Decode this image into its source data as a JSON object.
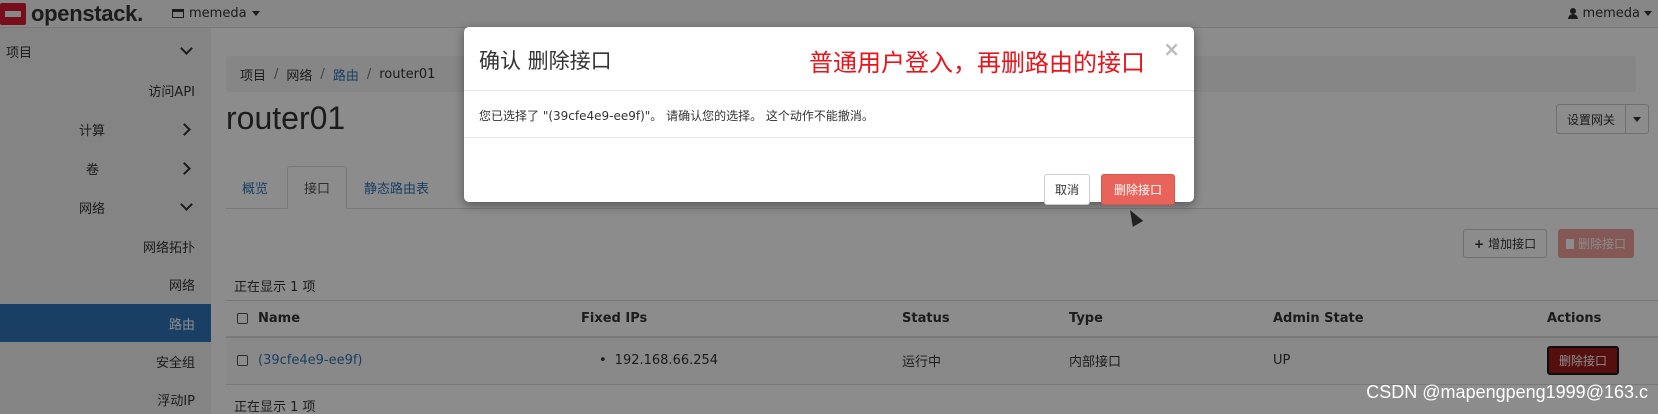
{
  "topbar": {
    "logo_text": "openstack.",
    "project_label": "memeda",
    "user_label": "memeda"
  },
  "sidebar": {
    "items": [
      {
        "label": "项目"
      },
      {
        "label": "访问API"
      },
      {
        "label": "计算"
      },
      {
        "label": "卷"
      },
      {
        "label": "网络"
      },
      {
        "label": "网络拓扑"
      },
      {
        "label": "网络"
      },
      {
        "label": "路由"
      },
      {
        "label": "安全组"
      },
      {
        "label": "浮动IP"
      }
    ]
  },
  "breadcrumb": {
    "items": [
      "项目",
      "网络",
      "路由",
      "router01"
    ]
  },
  "page": {
    "title": "router01",
    "gateway_button": "设置网关"
  },
  "tabs": [
    "概览",
    "接口",
    "静态路由表"
  ],
  "toolbar": {
    "add_label": "增加接口",
    "delete_label": "删除接口"
  },
  "table": {
    "count_top": "正在显示 1 项",
    "count_bottom": "正在显示 1 项",
    "headers": [
      "Name",
      "Fixed IPs",
      "Status",
      "Type",
      "Admin State",
      "Actions"
    ],
    "rows": [
      {
        "name": "(39cfe4e9-ee9f)",
        "fixed_ip": "192.168.66.254",
        "status": "运行中",
        "type": "内部接口",
        "admin_state": "UP",
        "action": "删除接口"
      }
    ]
  },
  "modal": {
    "title": "确认 删除接口",
    "annotation": "普通用户登入，再删路由的接口",
    "close": "×",
    "body": "您已选择了 \"(39cfe4e9-ee9f)\"。 请确认您的选择。 这个动作不能撤消。",
    "cancel_label": "取消",
    "confirm_label": "删除接口"
  },
  "watermark": "CSDN @mapengpeng1999@163.c",
  "colors": {
    "accent": "#2f73b6",
    "danger": "#e8645a",
    "annotation": "#e8141c"
  }
}
